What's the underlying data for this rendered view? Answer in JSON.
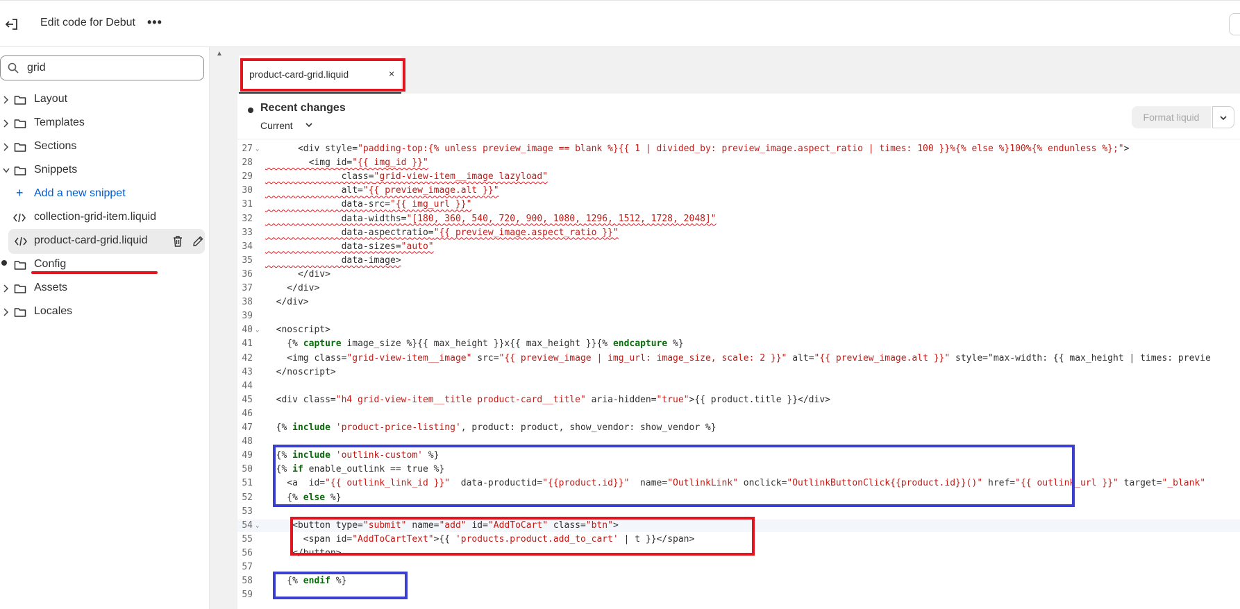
{
  "header": {
    "title": "Edit code for Debut",
    "more_label": "•••"
  },
  "sidebar": {
    "search_value": "grid",
    "folders": [
      {
        "label": "Layout"
      },
      {
        "label": "Templates"
      },
      {
        "label": "Sections"
      },
      {
        "label": "Snippets"
      }
    ],
    "add_snippet_label": "Add a new snippet",
    "snippet_files": [
      {
        "label": "collection-grid-item.liquid"
      },
      {
        "label": "product-card-grid.liquid"
      }
    ],
    "folders_after": [
      {
        "label": "Config"
      },
      {
        "label": "Assets"
      },
      {
        "label": "Locales"
      }
    ]
  },
  "editor": {
    "tab_label": "product-card-grid.liquid",
    "tab_close": "×",
    "changes_heading": "Recent changes",
    "version_label": "Current",
    "format_button": "Format liquid",
    "line_numbers": [
      "27",
      "28",
      "29",
      "30",
      "31",
      "32",
      "33",
      "34",
      "35",
      "36",
      "37",
      "38",
      "39",
      "40",
      "41",
      "42",
      "43",
      "44",
      "45",
      "46",
      "47",
      "48",
      "49",
      "50",
      "51",
      "52",
      "53",
      "54",
      "55",
      "56",
      "57",
      "58",
      "59"
    ],
    "code_lines": [
      "      <div style=\"padding-top:{% unless preview_image == blank %}{{ 1 | divided_by: preview_image.aspect_ratio | times: 100 }}%{% else %}100%{% endunless %};\">",
      "        <img id=\"{{ img_id }}\"",
      "              class=\"grid-view-item__image lazyload\"",
      "              alt=\"{{ preview_image.alt }}\"",
      "              data-src=\"{{ img_url }}\"",
      "              data-widths=\"[180, 360, 540, 720, 900, 1080, 1296, 1512, 1728, 2048]\"",
      "              data-aspectratio=\"{{ preview_image.aspect_ratio }}\"",
      "              data-sizes=\"auto\"",
      "              data-image>",
      "      </div>",
      "    </div>",
      "  </div>",
      "",
      "  <noscript>",
      "    {% capture image_size %}{{ max_height }}x{{ max_height }}{% endcapture %}",
      "    <img class=\"grid-view-item__image\" src=\"{{ preview_image | img_url: image_size, scale: 2 }}\" alt=\"{{ preview_image.alt }}\" style=\"max-width: {{ max_height | times: previe",
      "  </noscript>",
      "",
      "  <div class=\"h4 grid-view-item__title product-card__title\" aria-hidden=\"true\">{{ product.title }}</div>",
      "",
      "  {% include 'product-price-listing', product: product, show_vendor: show_vendor %}",
      "",
      "  {% include 'outlink-custom' %}",
      "  {% if enable_outlink == true %}",
      "    <a  id=\"{{ outlink_link_id }}\"  data-productid=\"{{product.id}}\"  name=\"OutlinkLink\" onclick=\"OutlinkButtonClick{{product.id}}()\" href=\"{{ outlink_url }}\" target=\"_blank\"",
      "    {% else %}",
      "",
      "     <button type=\"submit\" name=\"add\" id=\"AddToCart\" class=\"btn\">",
      "       <span id=\"AddToCartText\">{{ 'products.product.add_to_cart' | t }}</span>",
      "     </button>",
      "",
      "    {% endif %}",
      ""
    ]
  }
}
